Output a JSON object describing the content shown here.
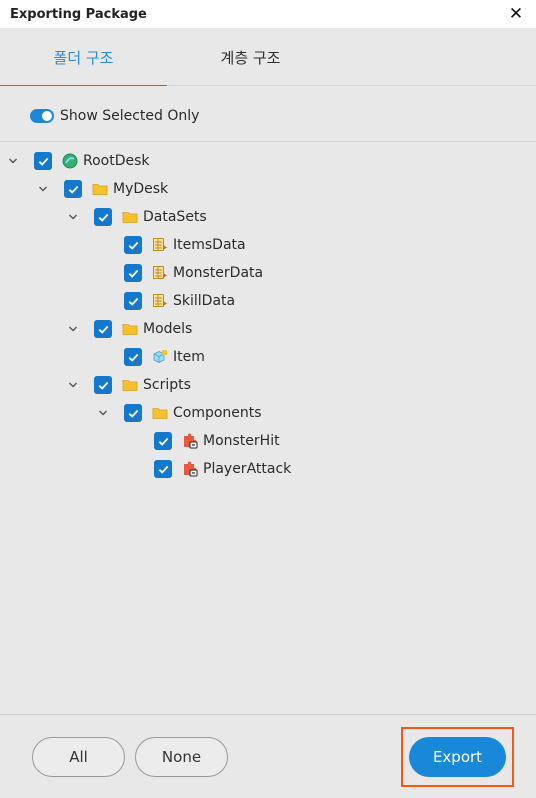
{
  "window": {
    "title": "Exporting Package",
    "close_glyph": "✕"
  },
  "tabs": [
    {
      "label": "폴더 구조",
      "active": true
    },
    {
      "label": "계층 구조",
      "active": false
    }
  ],
  "toggle": {
    "label": "Show Selected Only",
    "on": true
  },
  "tree": [
    {
      "label": "RootDesk",
      "icon": "globe-icon",
      "depth": 0,
      "expandable": true,
      "checked": true
    },
    {
      "label": "MyDesk",
      "icon": "folder-icon",
      "depth": 1,
      "expandable": true,
      "checked": true
    },
    {
      "label": "DataSets",
      "icon": "folder-icon",
      "depth": 2,
      "expandable": true,
      "checked": true
    },
    {
      "label": "ItemsData",
      "icon": "dataset-icon",
      "depth": 3,
      "expandable": false,
      "checked": true
    },
    {
      "label": "MonsterData",
      "icon": "dataset-icon",
      "depth": 3,
      "expandable": false,
      "checked": true
    },
    {
      "label": "SkillData",
      "icon": "dataset-icon",
      "depth": 3,
      "expandable": false,
      "checked": true
    },
    {
      "label": "Models",
      "icon": "folder-icon",
      "depth": 2,
      "expandable": true,
      "checked": true
    },
    {
      "label": "Item",
      "icon": "model-icon",
      "depth": 3,
      "expandable": false,
      "checked": true
    },
    {
      "label": "Scripts",
      "icon": "folder-icon",
      "depth": 2,
      "expandable": true,
      "checked": true
    },
    {
      "label": "Components",
      "icon": "folder-icon",
      "depth": 3,
      "expandable": true,
      "checked": true
    },
    {
      "label": "MonsterHit",
      "icon": "script-icon",
      "depth": 4,
      "expandable": false,
      "checked": true
    },
    {
      "label": "PlayerAttack",
      "icon": "script-icon",
      "depth": 4,
      "expandable": false,
      "checked": true
    }
  ],
  "footer": {
    "all_label": "All",
    "none_label": "None",
    "export_label": "Export"
  },
  "colors": {
    "accent": "#2a8bd9",
    "checkbox": "#1478cc",
    "export_button": "#1a88d8",
    "highlight_outline": "#f05a14",
    "folder": "#f6c12b"
  }
}
